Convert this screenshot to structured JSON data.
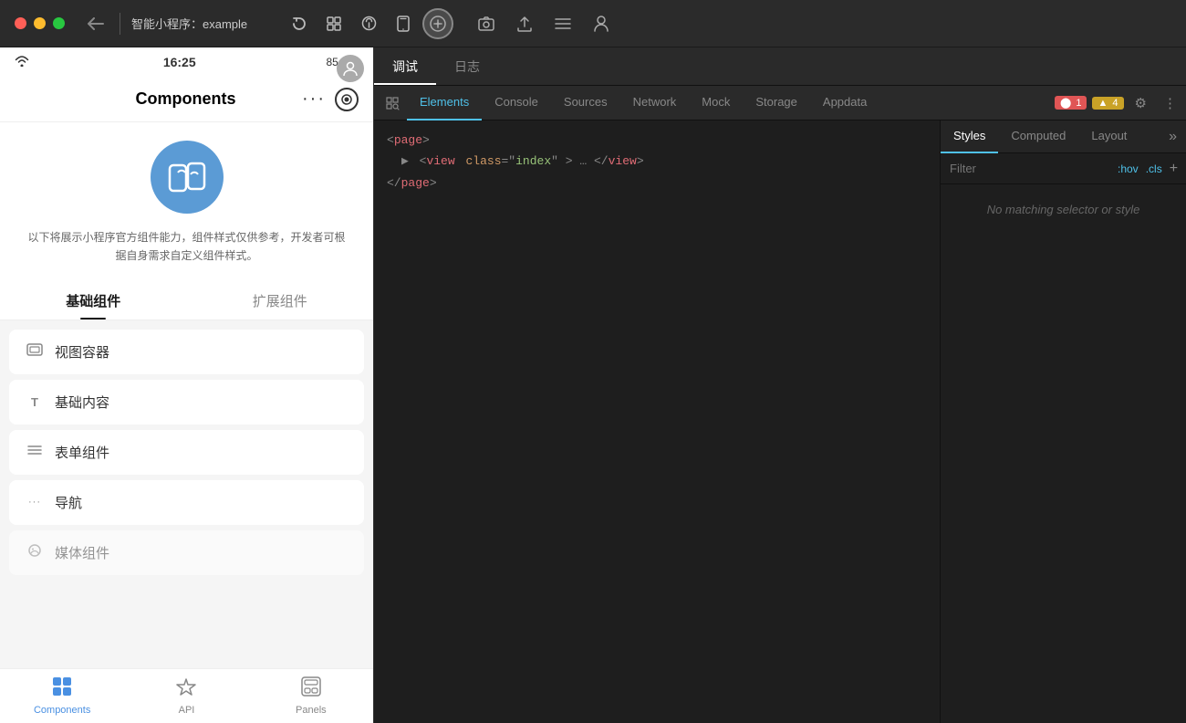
{
  "titlebar": {
    "title": "智能小程序：example",
    "back_label": "←",
    "tools": [
      {
        "name": "reload",
        "icon": "↻",
        "label": "Reload"
      },
      {
        "name": "switch",
        "icon": "⊞",
        "label": "Switch"
      },
      {
        "name": "debug",
        "icon": "🐛",
        "label": "Debug"
      },
      {
        "name": "device",
        "icon": "📱",
        "label": "Device"
      },
      {
        "name": "cursor",
        "icon": "⊙",
        "label": "Cursor",
        "active": true
      }
    ],
    "right_tools": [
      {
        "name": "screenshot",
        "icon": "⊡",
        "label": "Screenshot"
      },
      {
        "name": "upload",
        "icon": "↑",
        "label": "Upload"
      },
      {
        "name": "menu",
        "icon": "≡",
        "label": "Menu"
      },
      {
        "name": "user",
        "icon": "👤",
        "label": "User"
      }
    ]
  },
  "phone": {
    "statusbar": {
      "time": "16:25",
      "battery": "85"
    },
    "navbar": {
      "title": "Components",
      "dots": "···"
    },
    "hero": {
      "desc": "以下将展示小程序官方组件能力，组件样式仅供参考，开发者可根据自身需求自定义组件样式。"
    },
    "tabs": [
      {
        "label": "基础组件",
        "active": true
      },
      {
        "label": "扩展组件",
        "active": false
      }
    ],
    "list_items": [
      {
        "icon": "▣",
        "label": "视图容器"
      },
      {
        "icon": "T",
        "label": "基础内容"
      },
      {
        "icon": "≡",
        "label": "表单组件"
      },
      {
        "icon": "···",
        "label": "导航"
      },
      {
        "icon": "↗",
        "label": "媒体组件",
        "faded": true
      }
    ],
    "tabbar": [
      {
        "label": "Components",
        "icon": "⊞",
        "active": true
      },
      {
        "label": "API",
        "icon": "⚡",
        "active": false
      },
      {
        "label": "Panels",
        "icon": "▦",
        "active": false
      }
    ]
  },
  "debug_tabs": [
    {
      "label": "调试",
      "active": true
    },
    {
      "label": "日志",
      "active": false
    }
  ],
  "elements_tabs": [
    {
      "label": "Elements",
      "active": true
    },
    {
      "label": "Console",
      "active": false
    },
    {
      "label": "Sources",
      "active": false
    },
    {
      "label": "Network",
      "active": false
    },
    {
      "label": "Mock",
      "active": false
    },
    {
      "label": "Storage",
      "active": false
    },
    {
      "label": "Appdata",
      "active": false
    }
  ],
  "badges": {
    "red": "1",
    "yellow": "4"
  },
  "dom_tree": {
    "lines": [
      {
        "indent": 0,
        "content": "<page>"
      },
      {
        "indent": 1,
        "content": "▶ <view class=\"index\">…</view>"
      },
      {
        "indent": 0,
        "content": "</page>"
      }
    ]
  },
  "styles_tabs": [
    {
      "label": "Styles",
      "active": true
    },
    {
      "label": "Computed",
      "active": false
    },
    {
      "label": "Layout",
      "active": false
    }
  ],
  "styles_filter": {
    "placeholder": "Filter",
    "hov_label": ":hov",
    "cls_label": ".cls",
    "plus_label": "+",
    "grid_label": "⊞",
    "square_label": "□"
  },
  "styles_empty_text": "No matching selector or style"
}
